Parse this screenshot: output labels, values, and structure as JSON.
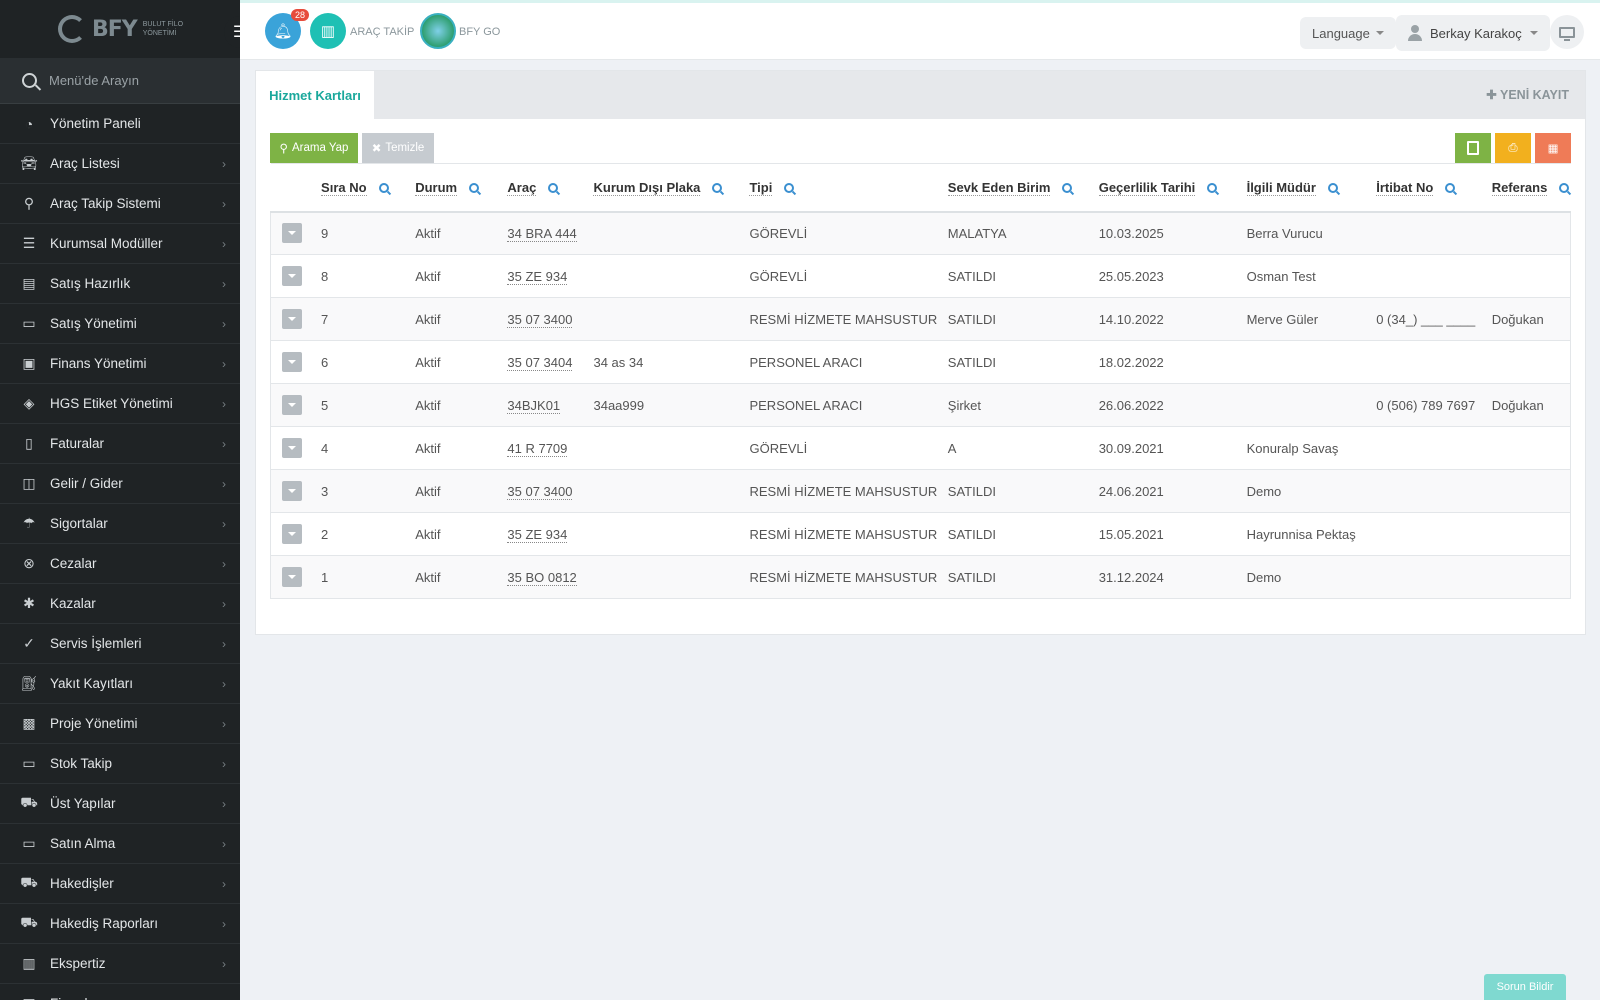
{
  "brand": {
    "name": "BFY",
    "subtitle": "BULUT FİLO YÖNETİMİ"
  },
  "sidebar": {
    "search_placeholder": "Menü'de Arayın",
    "items": [
      {
        "label": "Yönetim Paneli",
        "icon": "dashboard-icon"
      },
      {
        "label": "Araç Listesi",
        "icon": "car-icon"
      },
      {
        "label": "Araç Takip Sistemi",
        "icon": "map-marker-icon"
      },
      {
        "label": "Kurumsal Modüller",
        "icon": "server-icon"
      },
      {
        "label": "Satış Hazırlık",
        "icon": "book-icon"
      },
      {
        "label": "Satış Yönetimi",
        "icon": "credit-card-icon"
      },
      {
        "label": "Finans Yönetimi",
        "icon": "money-icon"
      },
      {
        "label": "HGS Etiket Yönetimi",
        "icon": "tag-icon"
      },
      {
        "label": "Faturalar",
        "icon": "file-icon"
      },
      {
        "label": "Gelir / Gider",
        "icon": "money-bill-icon"
      },
      {
        "label": "Sigortalar",
        "icon": "umbrella-icon"
      },
      {
        "label": "Cezalar",
        "icon": "times-circle-icon"
      },
      {
        "label": "Kazalar",
        "icon": "crash-icon"
      },
      {
        "label": "Servis İşlemleri",
        "icon": "check-circle-icon"
      },
      {
        "label": "Yakıt Kayıtları",
        "icon": "fuel-icon"
      },
      {
        "label": "Proje Yönetimi",
        "icon": "briefcase-icon"
      },
      {
        "label": "Stok Takip",
        "icon": "inbox-icon"
      },
      {
        "label": "Üst Yapılar",
        "icon": "truck-icon"
      },
      {
        "label": "Satın Alma",
        "icon": "credit-card-icon"
      },
      {
        "label": "Hakedişler",
        "icon": "truck-icon"
      },
      {
        "label": "Hakediş Raporları",
        "icon": "truck-icon"
      },
      {
        "label": "Ekspertiz",
        "icon": "list-icon"
      },
      {
        "label": "Firmalar",
        "icon": "building-icon"
      }
    ]
  },
  "topbar": {
    "notification_count": "28",
    "arac_takip_label": "ARAÇ TAKİP",
    "bfy_go_label": "BFY GO",
    "language_label": "Language",
    "user_name": "Berkay Karakoç"
  },
  "panel": {
    "tab_label": "Hizmet Kartları",
    "new_record_label": "✚ YENİ KAYIT",
    "search_button": "Arama Yap",
    "clear_button": "Temizle"
  },
  "table": {
    "columns": [
      "Sıra No",
      "Durum",
      "Araç",
      "Kurum Dışı Plaka",
      "Tipi",
      "Sevk Eden Birim",
      "Geçerlilik Tarihi",
      "İlgili Müdür",
      "İrtibat No",
      "Referans"
    ],
    "rows": [
      [
        "9",
        "Aktif",
        "34 BRA 444",
        "",
        "GÖREVLİ",
        "MALATYA",
        "10.03.2025",
        "Berra Vurucu",
        "",
        ""
      ],
      [
        "8",
        "Aktif",
        "35 ZE 934",
        "",
        "GÖREVLİ",
        "SATILDI",
        "25.05.2023",
        "Osman Test",
        "",
        ""
      ],
      [
        "7",
        "Aktif",
        "35 07 3400",
        "",
        "RESMİ HİZMETE MAHSUSTUR",
        "SATILDI",
        "14.10.2022",
        "Merve Güler",
        "0 (34_) ___ ____",
        "Doğukan"
      ],
      [
        "6",
        "Aktif",
        "35 07 3404",
        "34 as 34",
        "PERSONEL ARACI",
        "SATILDI",
        "18.02.2022",
        "",
        "",
        ""
      ],
      [
        "5",
        "Aktif",
        "34BJK01",
        "34aa999",
        "PERSONEL ARACI",
        "Şirket",
        "26.06.2022",
        "",
        "0 (506) 789 7697",
        "Doğukan"
      ],
      [
        "4",
        "Aktif",
        "41 R 7709",
        "",
        "GÖREVLİ",
        "A",
        "30.09.2021",
        "Konuralp Savaş",
        "",
        ""
      ],
      [
        "3",
        "Aktif",
        "35 07 3400",
        "",
        "RESMİ HİZMETE MAHSUSTUR",
        "SATILDI",
        "24.06.2021",
        "Demo",
        "",
        ""
      ],
      [
        "2",
        "Aktif",
        "35 ZE 934",
        "",
        "RESMİ HİZMETE MAHSUSTUR",
        "SATILDI",
        "15.05.2021",
        "Hayrunnisa Pektaş",
        "",
        ""
      ],
      [
        "1",
        "Aktif",
        "35 BO 0812",
        "",
        "RESMİ HİZMETE MAHSUSTUR",
        "SATILDI",
        "31.12.2024",
        "Demo",
        "",
        ""
      ]
    ]
  },
  "footer": {
    "report_button": "Sorun Bildir"
  },
  "colors": {
    "accent": "#1aa89c",
    "sidebar_bg": "#1f2325",
    "search_btn": "#7eb345",
    "print_btn": "#f2b01e",
    "cols_btn": "#ef7b57"
  }
}
